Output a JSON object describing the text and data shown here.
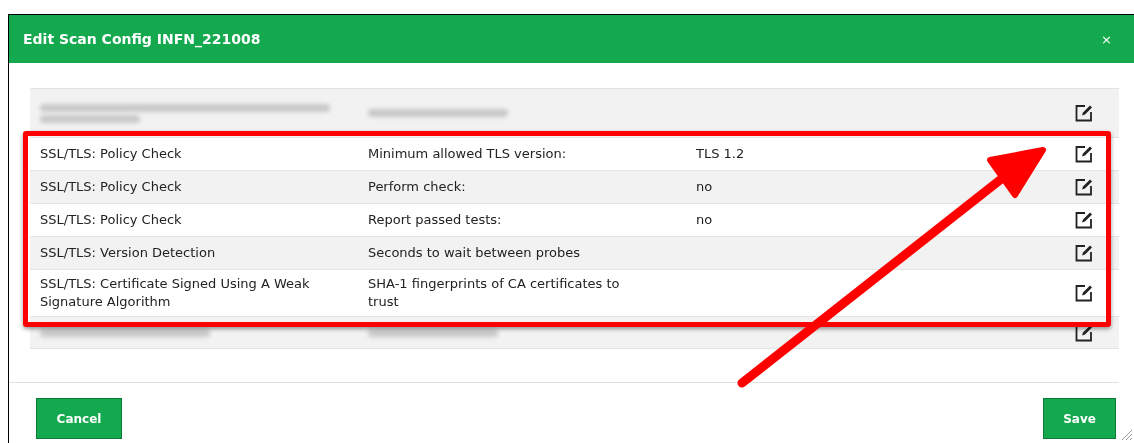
{
  "dialog": {
    "title": "Edit Scan Config INFN_221008",
    "close": "×"
  },
  "rows": [
    {
      "kind": "blurred"
    },
    {
      "kind": "setting",
      "nvt": "SSL/TLS: Policy Check",
      "preference": "Minimum allowed TLS version:",
      "value": "TLS 1.2"
    },
    {
      "kind": "setting",
      "nvt": "SSL/TLS: Policy Check",
      "preference": "Perform check:",
      "value": "no"
    },
    {
      "kind": "setting",
      "nvt": "SSL/TLS: Policy Check",
      "preference": "Report passed tests:",
      "value": "no"
    },
    {
      "kind": "setting",
      "nvt": "SSL/TLS: Version Detection",
      "preference": "Seconds to wait between probes"
    },
    {
      "kind": "setting",
      "nvt": "SSL/TLS: Certificate Signed Using A Weak Signature Algorithm",
      "preference": "SHA-1 fingerprints of CA certificates to trust"
    },
    {
      "kind": "blurred"
    }
  ],
  "buttons": {
    "cancel": "Cancel",
    "save": "Save"
  }
}
